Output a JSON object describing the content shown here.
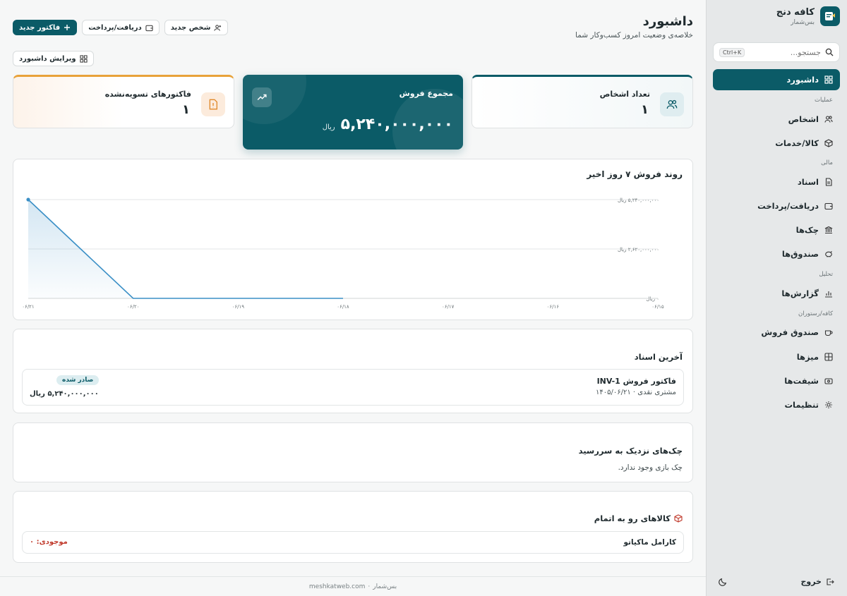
{
  "brand": {
    "title": "کافه دنج",
    "subtitle": "بس‌شمار"
  },
  "search": {
    "placeholder": "جستجو...",
    "shortcut": "Ctrl+K"
  },
  "nav": {
    "dashboard": "داشبورد",
    "group_ops": "عملیات",
    "people": "اشخاص",
    "products": "کالا/خدمات",
    "group_finance": "مالی",
    "documents": "اسناد",
    "payments": "دریافت/پرداخت",
    "checks": "چک‌ها",
    "cashboxes": "صندوق‌ها",
    "group_analysis": "تحلیل",
    "reports": "گزارش‌ها",
    "group_cafe": "کافه/رستوران",
    "pos": "صندوق فروش",
    "tables": "میزها",
    "shifts": "شیفت‌ها",
    "settings": "تنظیمات",
    "logout": "خروج"
  },
  "header": {
    "title": "داشبورد",
    "subtitle": "خلاصه‌ی وضعیت امروز کسب‌وکار شما",
    "new_invoice": "فاکتور جدید",
    "payment": "دریافت/پرداخت",
    "new_person": "شخص جدید",
    "edit_dashboard": "ویرایش داشبورد"
  },
  "stats": {
    "people_label": "تعداد اشخاص",
    "people_value": "۱",
    "sales_label": "مجموع فروش",
    "sales_value": "۵,۲۴۰,۰۰۰,۰۰۰",
    "sales_unit": "ریال",
    "unsettled_label": "فاکتورهای تسویه‌نشده",
    "unsettled_value": "۱"
  },
  "chart_data": {
    "type": "area",
    "title": "روند فروش ۷ روز اخیر",
    "x": [
      "۰۶/۱۵",
      "۰۶/۱۶",
      "۰۶/۱۷",
      "۰۶/۱۸",
      "۰۶/۱۹",
      "۰۶/۲۰",
      "۰۶/۲۱"
    ],
    "values": [
      null,
      null,
      null,
      0,
      0,
      0,
      5240000000
    ],
    "y_ticks": [
      "۰ ریال",
      "۲,۶۲۰,۰۰۰,۰۰۰ ریال",
      "۵,۲۴۰,۰۰۰,۰۰۰ ریال"
    ],
    "ylim": [
      0,
      5240000000
    ],
    "grid": true,
    "color": "#3a8fc6"
  },
  "docs": {
    "title": "آخرین اسناد",
    "items": [
      {
        "name": "فاکتور فروش INV-1",
        "sub": "مشتری نقدی · ۱۴۰۵/۰۶/۲۱",
        "status": "صادر شده",
        "amount": "۵,۲۴۰,۰۰۰,۰۰۰ ریال"
      }
    ]
  },
  "checks": {
    "title": "چک‌های نزدیک به سررسید",
    "empty": "چک بازی وجود ندارد."
  },
  "stock": {
    "title": "کالاهای رو به اتمام",
    "items": [
      {
        "name": "کارامل ماکیاتو",
        "qty": "موجودی: ۰"
      }
    ]
  },
  "footer": {
    "brand": "بس‌شمار",
    "sep": "·",
    "site": "meshkatweb.com"
  },
  "colors": {
    "primary": "#0b5b67",
    "accent_orange": "#e8a23a",
    "danger": "#c0392b"
  }
}
